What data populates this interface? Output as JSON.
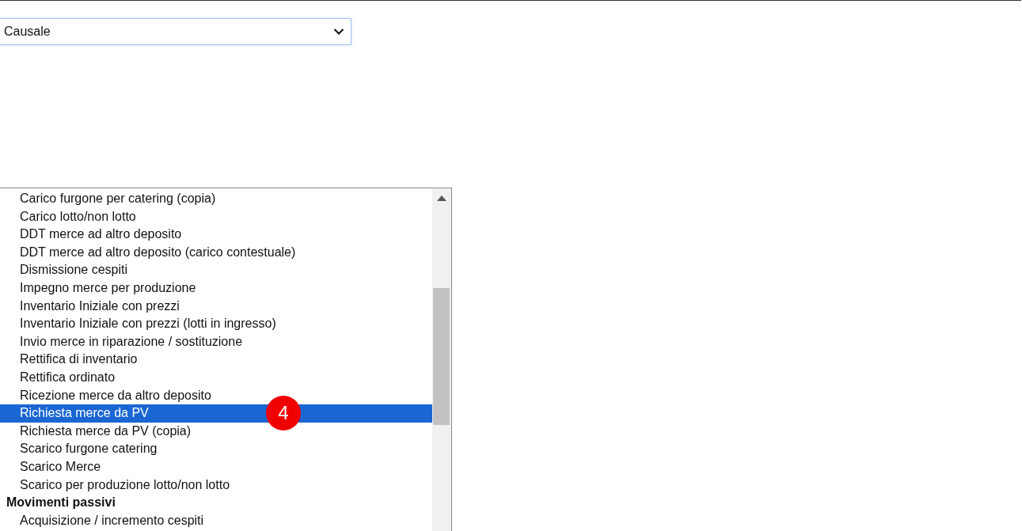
{
  "select": {
    "value": "Causale"
  },
  "options": [
    {
      "kind": "option",
      "label": "Carico furgone per catering (copia)",
      "selected": false
    },
    {
      "kind": "option",
      "label": "Carico lotto/non lotto",
      "selected": false
    },
    {
      "kind": "option",
      "label": "DDT merce ad altro deposito",
      "selected": false
    },
    {
      "kind": "option",
      "label": "DDT merce ad altro deposito (carico contestuale)",
      "selected": false
    },
    {
      "kind": "option",
      "label": "Dismissione cespiti",
      "selected": false
    },
    {
      "kind": "option",
      "label": "Impegno merce per produzione",
      "selected": false
    },
    {
      "kind": "option",
      "label": "Inventario Iniziale con prezzi",
      "selected": false
    },
    {
      "kind": "option",
      "label": "Inventario Iniziale con prezzi (lotti in ingresso)",
      "selected": false
    },
    {
      "kind": "option",
      "label": "Invio merce in riparazione / sostituzione",
      "selected": false
    },
    {
      "kind": "option",
      "label": "Rettifica di inventario",
      "selected": false
    },
    {
      "kind": "option",
      "label": "Rettifica ordinato",
      "selected": false
    },
    {
      "kind": "option",
      "label": "Ricezione merce da altro deposito",
      "selected": false
    },
    {
      "kind": "option",
      "label": "Richiesta merce da PV",
      "selected": true,
      "badge": "4"
    },
    {
      "kind": "option",
      "label": "Richiesta merce da PV (copia)",
      "selected": false
    },
    {
      "kind": "option",
      "label": "Scarico furgone catering",
      "selected": false
    },
    {
      "kind": "option",
      "label": "Scarico Merce",
      "selected": false
    },
    {
      "kind": "option",
      "label": "Scarico per produzione lotto/non lotto",
      "selected": false
    },
    {
      "kind": "group",
      "label": "Movimenti passivi"
    },
    {
      "kind": "option",
      "label": "Acquisizione / incremento cespiti",
      "selected": false
    }
  ]
}
